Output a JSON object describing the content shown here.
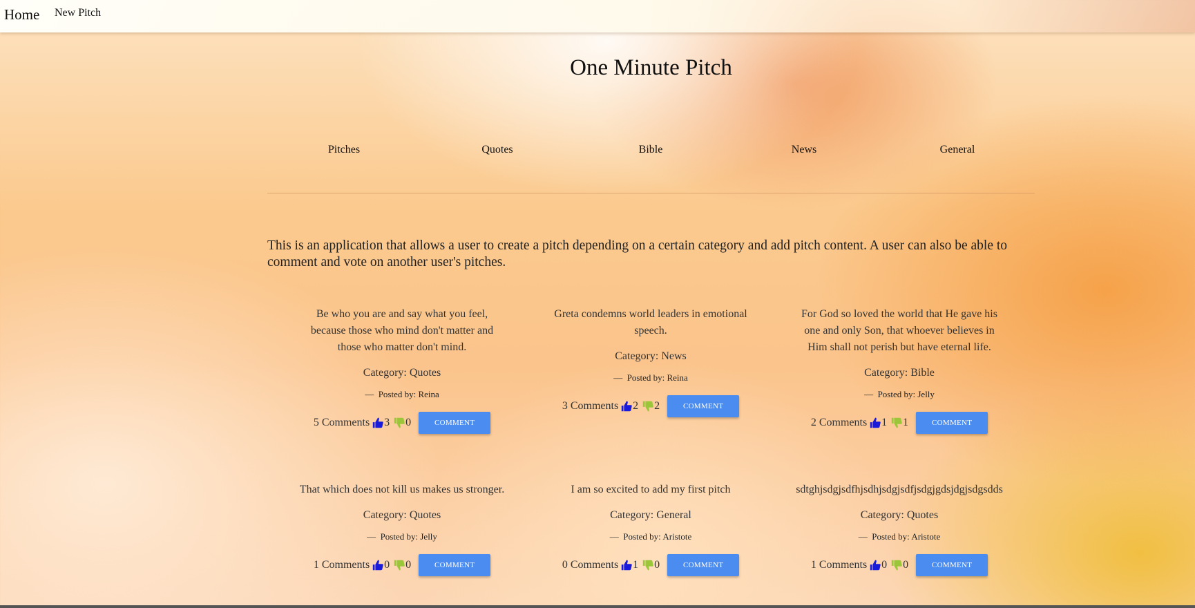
{
  "nav": {
    "home": "Home",
    "new_pitch": "New Pitch"
  },
  "site_title": "One Minute Pitch",
  "categories": [
    "Pitches",
    "Quotes",
    "Bible",
    "News",
    "General"
  ],
  "intro": "This is an application that allows a user to create a pitch depending on a certain category and add pitch content. A user can also be able to comment and vote on another user's pitches.",
  "comment_button_label": "COMMENT",
  "pitches": [
    {
      "content": "Be who you are and say what you feel, because those who mind don't matter and those who matter don't mind.",
      "category": "Category: Quotes",
      "author": "Posted by: Reina",
      "comments": "5 Comments",
      "upvotes": "3",
      "downvotes": "0"
    },
    {
      "content": "Greta condemns world leaders in emotional speech.",
      "category": "Category: News",
      "author": "Posted by: Reina",
      "comments": "3 Comments",
      "upvotes": "2",
      "downvotes": "2"
    },
    {
      "content": "For God so loved the world that He gave his one and only Son, that whoever believes in Him shall not perish but have eternal life.",
      "category": "Category: Bible",
      "author": "Posted by: Jelly",
      "comments": "2 Comments",
      "upvotes": "1",
      "downvotes": "1"
    },
    {
      "content": "That which does not kill us makes us stronger.",
      "category": "Category: Quotes",
      "author": "Posted by: Jelly",
      "comments": "1 Comments",
      "upvotes": "0",
      "downvotes": "0"
    },
    {
      "content": "I am so excited to add my first pitch",
      "category": "Category: General",
      "author": "Posted by: Aristote",
      "comments": "0 Comments",
      "upvotes": "1",
      "downvotes": "0"
    },
    {
      "content": "sdtghjsdgjsdfhjsdhjsdgjsdfjsdgjgdsjdgjsdgsdds",
      "category": "Category: Quotes",
      "author": "Posted by: Aristote",
      "comments": "1 Comments",
      "upvotes": "0",
      "downvotes": "0"
    }
  ],
  "colors": {
    "upvote": "#1a1adb",
    "downvote": "#9cc63a",
    "button": "#4a8cf0"
  },
  "icons": {
    "upvote": "thumbs-up-icon",
    "downvote": "thumbs-down-icon"
  }
}
